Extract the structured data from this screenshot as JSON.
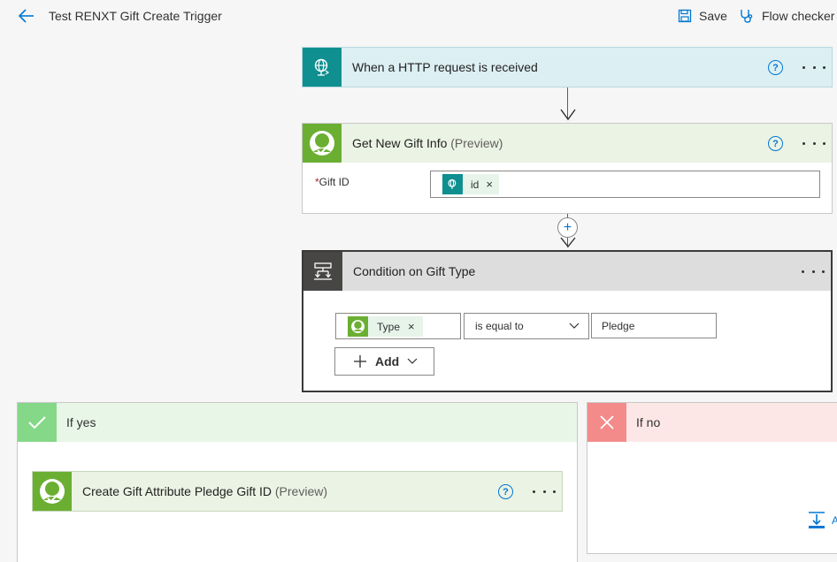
{
  "header": {
    "title": "Test RENXT Gift Create Trigger",
    "save_label": "Save",
    "checker_label": "Flow checker"
  },
  "trigger": {
    "title": "When a HTTP request is received",
    "help": "?"
  },
  "get_gift": {
    "title": "Get New Gift Info",
    "suffix": "(Preview)",
    "help": "?",
    "field_required": "*",
    "field_label": "Gift ID",
    "token_label": "id",
    "token_close": "×"
  },
  "insert_step": {
    "symbol": "+"
  },
  "condition": {
    "title": "Condition on Gift Type",
    "left_token": "Type",
    "left_token_close": "×",
    "operator": "is equal to",
    "value": "Pledge",
    "add_label": "Add"
  },
  "if_yes": {
    "title": "If yes",
    "action_title": "Create Gift Attribute Pledge Gift ID",
    "action_suffix": "(Preview)",
    "action_help": "?"
  },
  "if_no": {
    "title": "If no",
    "add_action_partial": "A"
  },
  "colors": {
    "http_teal": "#0f8f8f",
    "http_header_bg": "#dceff3",
    "blackbaud_green": "#6aaf32",
    "green_header_bg": "#ebf3e4",
    "condition_dark": "#484644",
    "condition_header_bg": "#dddddd",
    "yes_green": "#84d888",
    "yes_header_bg": "#e8f6e8",
    "no_red": "#f38b8b",
    "no_header_bg": "#fde6e6",
    "link_blue": "#0078d4"
  }
}
